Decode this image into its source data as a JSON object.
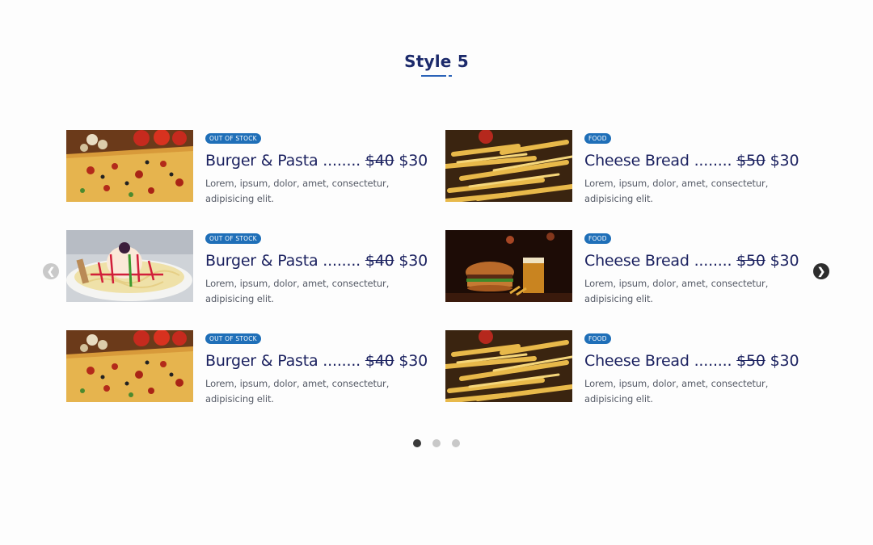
{
  "section": {
    "title": "Style 5"
  },
  "carousel": {
    "prev_icon": "chevron-left-icon",
    "next_icon": "chevron-right-icon",
    "dots": [
      {
        "active": true
      },
      {
        "active": false
      },
      {
        "active": false
      }
    ]
  },
  "colors": {
    "badge": "#1f6fb8",
    "text": "#1c2260",
    "accent": "#2b63b8"
  },
  "menu": {
    "items": [
      {
        "badge": "Out of stock",
        "name": "Burger & Pasta",
        "leader": "........",
        "old_price": "$40",
        "price": "$30",
        "desc": "Lorem, ipsum, dolor, amet, consectetur, adipisicing elit.",
        "image": "pizza"
      },
      {
        "badge": "Food",
        "name": "Cheese Bread",
        "leader": "........",
        "old_price": "$50",
        "price": "$30",
        "desc": "Lorem, ipsum, dolor, amet, consectetur, adipisicing elit.",
        "image": "fries"
      },
      {
        "badge": "Out of stock",
        "name": "Burger & Pasta",
        "leader": "........",
        "old_price": "$40",
        "price": "$30",
        "desc": "Lorem, ipsum, dolor, amet, consectetur, adipisicing elit.",
        "image": "icecream-pasta"
      },
      {
        "badge": "Food",
        "name": "Cheese Bread",
        "leader": "........",
        "old_price": "$50",
        "price": "$30",
        "desc": "Lorem, ipsum, dolor, amet, consectetur, adipisicing elit.",
        "image": "burger-beer"
      },
      {
        "badge": "Out of stock",
        "name": "Burger & Pasta",
        "leader": "........",
        "old_price": "$40",
        "price": "$30",
        "desc": "Lorem, ipsum, dolor, amet, consectetur, adipisicing elit.",
        "image": "pizza"
      },
      {
        "badge": "Food",
        "name": "Cheese Bread",
        "leader": "........",
        "old_price": "$50",
        "price": "$30",
        "desc": "Lorem, ipsum, dolor, amet, consectetur, adipisicing elit.",
        "image": "fries"
      }
    ]
  }
}
